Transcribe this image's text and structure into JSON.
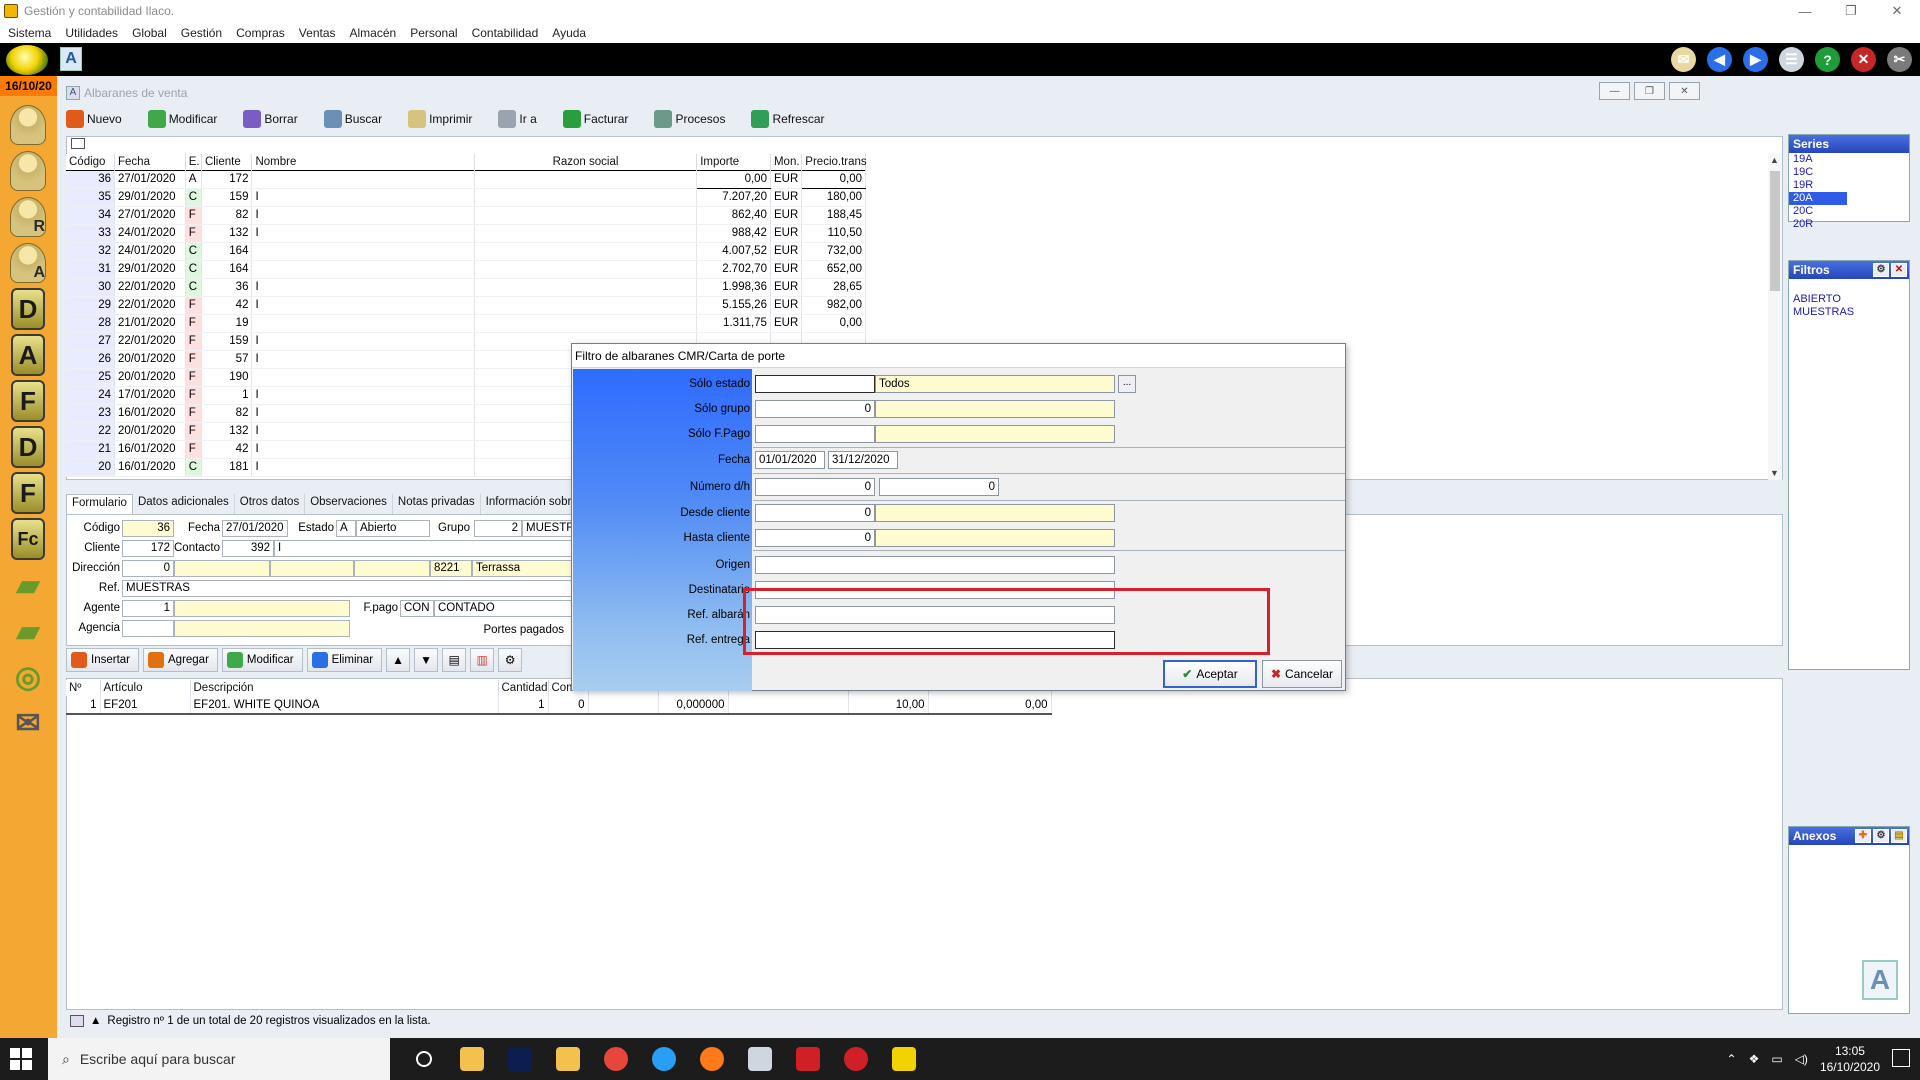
{
  "window": {
    "title": "Gestión y contabilidad Ilaco.",
    "controls": [
      "—",
      "❐",
      "✕"
    ]
  },
  "menu": [
    "Sistema",
    "Utilidades",
    "Global",
    "Gestión",
    "Compras",
    "Ventas",
    "Almacén",
    "Personal",
    "Contabilidad",
    "Ayuda"
  ],
  "appbar": {
    "a_label": "A",
    "icons": [
      {
        "name": "mail-icon",
        "color": "#e8d9a0",
        "glyph": "✉"
      },
      {
        "name": "back-icon",
        "color": "#2a6ee8",
        "glyph": "◀"
      },
      {
        "name": "forward-icon",
        "color": "#2a6ee8",
        "glyph": "▶"
      },
      {
        "name": "list-icon",
        "color": "#cfd6e0",
        "glyph": "☰"
      },
      {
        "name": "help-icon",
        "color": "#1e9e3a",
        "glyph": "?"
      },
      {
        "name": "close-app-icon",
        "color": "#c62828",
        "glyph": "✕"
      },
      {
        "name": "tools-icon",
        "color": "#7a7a7a",
        "glyph": "✂"
      }
    ]
  },
  "sidebar": {
    "date": "16/10/20",
    "items": [
      {
        "name": "clients-icon",
        "type": "person",
        "label": ""
      },
      {
        "name": "contacts-icon",
        "type": "person",
        "label": ""
      },
      {
        "name": "representatives-icon",
        "type": "person",
        "label": "R"
      },
      {
        "name": "agents-icon",
        "type": "person",
        "label": "A"
      },
      {
        "name": "letter-d-icon",
        "type": "letter",
        "label": "D"
      },
      {
        "name": "letter-a-icon",
        "type": "letter",
        "label": "A"
      },
      {
        "name": "letter-f-icon",
        "type": "letter",
        "label": "F"
      },
      {
        "name": "letter-d2-icon",
        "type": "letter",
        "label": "D"
      },
      {
        "name": "letter-f2-icon",
        "type": "letter",
        "label": "F"
      },
      {
        "name": "letter-fc-icon",
        "type": "letter",
        "label": "Fc"
      },
      {
        "name": "product-box-icon",
        "type": "shape",
        "label": "▰"
      },
      {
        "name": "box-icon",
        "type": "shape",
        "label": "▰"
      },
      {
        "name": "disc-icon",
        "type": "shape",
        "label": "◎"
      },
      {
        "name": "envelope-icon",
        "type": "shape",
        "label": "✉"
      }
    ]
  },
  "subwindow": {
    "title": "Albaranes de venta",
    "toolbar": [
      {
        "label": "Nuevo",
        "name": "nuevo-button",
        "color": "#e05a1a"
      },
      {
        "label": "Modificar",
        "name": "modificar-button",
        "color": "#3ea84a"
      },
      {
        "label": "Borrar",
        "name": "borrar-button",
        "color": "#7a5cc7"
      },
      {
        "label": "Buscar",
        "name": "buscar-button",
        "color": "#6b8fb5"
      },
      {
        "label": "Imprimir",
        "name": "imprimir-button",
        "color": "#d6c37d"
      },
      {
        "label": "Ir a",
        "name": "ir-a-button",
        "color": "#9aa4ae"
      },
      {
        "label": "Facturar",
        "name": "facturar-button",
        "color": "#2a9e3a"
      },
      {
        "label": "Procesos",
        "name": "procesos-button",
        "color": "#6a9a8a"
      },
      {
        "label": "Refrescar",
        "name": "refrescar-button",
        "color": "#2f9e58"
      }
    ]
  },
  "list": {
    "headers": [
      "Código",
      "Fecha",
      "E.",
      "Cliente",
      "Nombre",
      "Razon social",
      "Importe",
      "Mon.",
      "Precio.trans"
    ],
    "rows": [
      {
        "codigo": "36",
        "fecha": "27/01/2020",
        "e": "A",
        "cliente": "172",
        "nombre": "",
        "razon": "",
        "importe": "0,00",
        "mon": "EUR",
        "precio": "0,00"
      },
      {
        "codigo": "35",
        "fecha": "29/01/2020",
        "e": "C",
        "cliente": "159",
        "nombre": "I",
        "razon": "",
        "importe": "7.207,20",
        "mon": "EUR",
        "precio": "180,00"
      },
      {
        "codigo": "34",
        "fecha": "27/01/2020",
        "e": "F",
        "cliente": "82",
        "nombre": "I",
        "razon": "",
        "importe": "862,40",
        "mon": "EUR",
        "precio": "188,45"
      },
      {
        "codigo": "33",
        "fecha": "24/01/2020",
        "e": "F",
        "cliente": "132",
        "nombre": "I",
        "razon": "",
        "importe": "988,42",
        "mon": "EUR",
        "precio": "110,50"
      },
      {
        "codigo": "32",
        "fecha": "24/01/2020",
        "e": "C",
        "cliente": "164",
        "nombre": "",
        "razon": "",
        "importe": "4.007,52",
        "mon": "EUR",
        "precio": "732,00"
      },
      {
        "codigo": "31",
        "fecha": "29/01/2020",
        "e": "C",
        "cliente": "164",
        "nombre": "",
        "razon": "",
        "importe": "2.702,70",
        "mon": "EUR",
        "precio": "652,00"
      },
      {
        "codigo": "30",
        "fecha": "22/01/2020",
        "e": "C",
        "cliente": "36",
        "nombre": "I",
        "razon": "",
        "importe": "1.998,36",
        "mon": "EUR",
        "precio": "28,65"
      },
      {
        "codigo": "29",
        "fecha": "22/01/2020",
        "e": "F",
        "cliente": "42",
        "nombre": "I",
        "razon": "",
        "importe": "5.155,26",
        "mon": "EUR",
        "precio": "982,00"
      },
      {
        "codigo": "28",
        "fecha": "21/01/2020",
        "e": "F",
        "cliente": "19",
        "nombre": "",
        "razon": "",
        "importe": "1.311,75",
        "mon": "EUR",
        "precio": "0,00"
      },
      {
        "codigo": "27",
        "fecha": "22/01/2020",
        "e": "F",
        "cliente": "159",
        "nombre": "I",
        "razon": "",
        "importe": "",
        "mon": "",
        "precio": ""
      },
      {
        "codigo": "26",
        "fecha": "20/01/2020",
        "e": "F",
        "cliente": "57",
        "nombre": "I",
        "razon": "",
        "importe": "",
        "mon": "",
        "precio": ""
      },
      {
        "codigo": "25",
        "fecha": "20/01/2020",
        "e": "F",
        "cliente": "190",
        "nombre": "",
        "razon": "",
        "importe": "",
        "mon": "",
        "precio": ""
      },
      {
        "codigo": "24",
        "fecha": "17/01/2020",
        "e": "F",
        "cliente": "1",
        "nombre": "I",
        "razon": "",
        "importe": "",
        "mon": "",
        "precio": ""
      },
      {
        "codigo": "23",
        "fecha": "16/01/2020",
        "e": "F",
        "cliente": "82",
        "nombre": "I",
        "razon": "",
        "importe": "",
        "mon": "",
        "precio": ""
      },
      {
        "codigo": "22",
        "fecha": "20/01/2020",
        "e": "F",
        "cliente": "132",
        "nombre": "I",
        "razon": "",
        "importe": "",
        "mon": "",
        "precio": ""
      },
      {
        "codigo": "21",
        "fecha": "16/01/2020",
        "e": "F",
        "cliente": "42",
        "nombre": "I",
        "razon": "",
        "importe": "",
        "mon": "",
        "precio": ""
      },
      {
        "codigo": "20",
        "fecha": "16/01/2020",
        "e": "C",
        "cliente": "181",
        "nombre": "I",
        "razon": "",
        "importe": "",
        "mon": "",
        "precio": ""
      }
    ]
  },
  "right_panel": {
    "series_title": "Series",
    "series": [
      "19A",
      "19C",
      "19R",
      "20A",
      "20C",
      "20R"
    ],
    "series_selected": "20A",
    "filtros_title": "Filtros",
    "filtros": [
      "ABIERTO",
      "MUESTRAS"
    ],
    "anexos_title": "Anexos"
  },
  "tabs": [
    "Formulario",
    "Datos adicionales",
    "Otros datos",
    "Observaciones",
    "Notas privadas",
    "Información sobre el de"
  ],
  "form": {
    "codigo_label": "Código",
    "codigo": "36",
    "fecha_label": "Fecha",
    "fecha": "27/01/2020",
    "estado_label": "Estado",
    "estado_code": "A",
    "estado": "Abierto",
    "grupo_label": "Grupo",
    "grupo_code": "2",
    "grupo": "MUESTRA",
    "cliente_label": "Cliente",
    "cliente": "172",
    "contacto_label": "Contacto",
    "contacto": "392",
    "contacto_name": "I",
    "direccion_label": "Dirección",
    "direccion": "0",
    "cp": "8221",
    "poblacion": "Terrassa",
    "ref_label": "Ref.",
    "ref": "MUESTRAS",
    "agente_label": "Agente",
    "agente": "1",
    "fpago_label": "F.pago",
    "fpago_code": "CON",
    "fpago": "CONTADO",
    "agencia_label": "Agencia",
    "portes_label": "Portes pagados"
  },
  "line_toolbar": {
    "insertar": "Insertar",
    "agregar": "Agregar",
    "modificar": "Modificar",
    "eliminar": "Eliminar"
  },
  "lines": {
    "headers": [
      "Nº",
      "Artículo",
      "Descripción",
      "Cantidad",
      "Com"
    ],
    "rows": [
      {
        "n": "1",
        "articulo": "EF201",
        "descripcion": "EF201. WHITE QUINOA",
        "cantidad": "1",
        "com": "0",
        "c6": "0,000000",
        "c7": "10,00",
        "c8": "0,00"
      }
    ]
  },
  "status": "Registro nº 1 de un total de 20 registros visualizados en la lista.",
  "dialog": {
    "title": "Filtro de albaranes CMR/Carta de porte",
    "solo_estado_label": "Sólo estado",
    "solo_estado_code": "",
    "solo_estado": "Todos",
    "solo_grupo_label": "Sólo grupo",
    "solo_grupo": "0",
    "solo_fpago_label": "Sólo F.Pago",
    "fecha_label": "Fecha",
    "fecha_desde": "01/01/2020",
    "fecha_hasta": "31/12/2020",
    "numero_label": "Número d/h",
    "numero_desde": "0",
    "numero_hasta": "0",
    "desde_cliente_label": "Desde cliente",
    "desde_cliente": "0",
    "hasta_cliente_label": "Hasta cliente",
    "hasta_cliente": "0",
    "origen_label": "Origen",
    "destinatario_label": "Destinatario",
    "ref_albaran_label": "Ref. albarán",
    "ref_entrega_label": "Ref. entrega",
    "aceptar": "Aceptar",
    "cancelar": "Cancelar",
    "dots": "..."
  },
  "taskbar": {
    "search_placeholder": "Escribe aquí para buscar",
    "apps": [
      {
        "name": "task-view-icon",
        "color": "#1c1c1c"
      },
      {
        "name": "file-explorer-icon",
        "color": "#f2c14e"
      },
      {
        "name": "photoshop-icon",
        "color": "#0b1e4f"
      },
      {
        "name": "folder-icon",
        "color": "#f2c14e"
      },
      {
        "name": "chrome-icon",
        "color": "#e8463a"
      },
      {
        "name": "edge-icon",
        "color": "#2a9df4"
      },
      {
        "name": "firefox-icon",
        "color": "#ff7a1a"
      },
      {
        "name": "app-icon",
        "color": "#cfd6e0"
      },
      {
        "name": "rx-icon",
        "color": "#d01f26"
      },
      {
        "name": "opera-icon",
        "color": "#d01f26"
      },
      {
        "name": "gestion-app-icon",
        "color": "#f2d200"
      }
    ],
    "time": "13:05",
    "date": "16/10/2020"
  }
}
